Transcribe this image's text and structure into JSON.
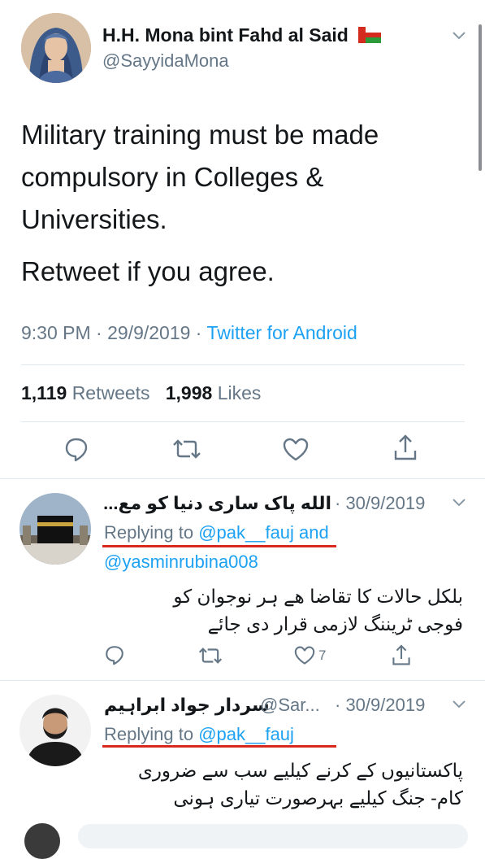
{
  "tweet": {
    "author_name": "H.H. Mona bint Fahd al Said",
    "author_handle": "@SayyidaMona",
    "text_line1": "Military training must be made compulsory in Colleges & Universities.",
    "text_line2": "Retweet if you agree.",
    "time": "9:30 PM · 29/9/2019 · ",
    "source": "Twitter for Android",
    "retweets_count": "1,119",
    "retweets_label": "Retweets",
    "likes_count": "1,998",
    "likes_label": "Likes"
  },
  "replies": [
    {
      "name": "الله پاک ساری دنیا کو مع...",
      "date": "· 30/9/2019",
      "replying_prefix": "Replying to ",
      "replying_link1": "@pak__fauj and",
      "replying_link2": "@yasminrubina008",
      "body_line1": "بلکل حالات کا تقاضا ھے ہر نوجوان کو",
      "body_line2": "فوجی ٹریننگ لازمی قرار دی جائے",
      "like_count": "7"
    },
    {
      "name": "سردار جواد ابراہیم",
      "handle": "@Sar...",
      "date": "· 30/9/2019",
      "replying_prefix": "Replying to ",
      "replying_link1": "@pak__fauj",
      "body_line1": "پاکستانیوں کے کرنے کیلیے سب سے ضروری",
      "body_line2": "کام- جنگ کیلیے بہرصورت تیاری ہونی"
    }
  ],
  "colors": {
    "accent": "#1da1f2",
    "secondary_text": "#657786",
    "annotation_red": "#d9281d"
  },
  "icons": [
    "reply-icon",
    "retweet-icon",
    "like-icon",
    "share-icon",
    "chevron-down-icon",
    "oman-flag-icon"
  ]
}
